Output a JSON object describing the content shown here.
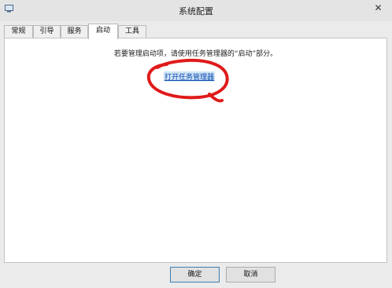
{
  "window": {
    "title": "系统配置",
    "close_glyph": "✕"
  },
  "tabs": [
    {
      "label": "常规",
      "active": false
    },
    {
      "label": "引导",
      "active": false
    },
    {
      "label": "服务",
      "active": false
    },
    {
      "label": "启动",
      "active": true
    },
    {
      "label": "工具",
      "active": false
    }
  ],
  "startup_panel": {
    "info_text": "若要管理启动项，请使用任务管理器的“启动”部分。",
    "link_text": "打开任务管理器"
  },
  "buttons": {
    "ok_label": "确定",
    "cancel_label": "取消"
  },
  "icons": {
    "title_icon": "system-config-icon",
    "annotation": "red-circle-annotation"
  },
  "colors": {
    "link": "#0b4bb3",
    "annotation": "#e01a1a",
    "background": "#ebebeb",
    "panel": "#ffffff"
  }
}
